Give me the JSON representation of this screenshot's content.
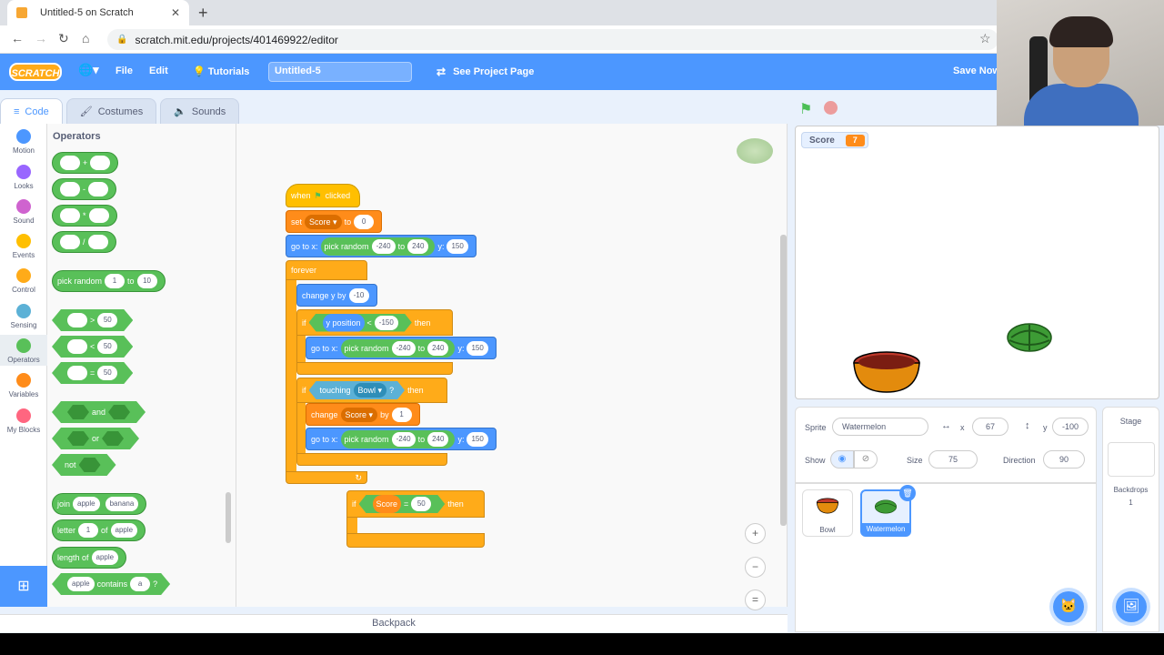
{
  "browser": {
    "tab_title": "Untitled-5 on Scratch",
    "url": "scratch.mit.edu/projects/401469922/editor"
  },
  "menubar": {
    "logo": "SCRATCH",
    "file": "File",
    "edit": "Edit",
    "tutorials": "Tutorials",
    "project_title": "Untitled-5",
    "see_project": "See Project Page",
    "save_now": "Save Now"
  },
  "tabs": {
    "code": "Code",
    "costumes": "Costumes",
    "sounds": "Sounds"
  },
  "categories": [
    {
      "label": "Motion",
      "color": "#4c97ff"
    },
    {
      "label": "Looks",
      "color": "#9966ff"
    },
    {
      "label": "Sound",
      "color": "#cf63cf"
    },
    {
      "label": "Events",
      "color": "#ffbf00"
    },
    {
      "label": "Control",
      "color": "#ffab19"
    },
    {
      "label": "Sensing",
      "color": "#5cb1d6"
    },
    {
      "label": "Operators",
      "color": "#59c059"
    },
    {
      "label": "Variables",
      "color": "#ff8c1a"
    },
    {
      "label": "My Blocks",
      "color": "#ff6680"
    }
  ],
  "palette": {
    "title": "Operators",
    "plus": "+",
    "minus": "-",
    "times": "*",
    "divide": "/",
    "pick_random": "pick random",
    "to": "to",
    "rand_from": "1",
    "rand_to": "10",
    "gt": ">",
    "lt": "<",
    "eq": "=",
    "cmp_val": "50",
    "and": "and",
    "or": "or",
    "not": "not",
    "join": "join",
    "join_a": "apple",
    "join_b": "banana",
    "letter": "letter",
    "letter_n": "1",
    "of": "of",
    "letter_word": "apple",
    "length_of": "length of",
    "length_word": "apple",
    "contains_word": "apple",
    "contains": "contains",
    "contains_char": "a",
    "q": "?"
  },
  "script": {
    "when": "when",
    "clicked": "clicked",
    "set": "set",
    "score_var": "Score",
    "to": "to",
    "set_val": "0",
    "go_to": "go to x:",
    "pick_random": "pick random",
    "r_from": "-240",
    "r_to": "240",
    "y": "y:",
    "y_val": "150",
    "forever": "forever",
    "change_y": "change y by",
    "change_y_val": "-10",
    "if": "if",
    "then": "then",
    "y_position": "y position",
    "lt": "<",
    "y_limit": "-150",
    "touching": "touching",
    "bowl": "Bowl",
    "q": "?",
    "change": "change",
    "by": "by",
    "change_val": "1",
    "eq": "=",
    "score_target": "50"
  },
  "stage": {
    "monitor_label": "Score",
    "monitor_value": "7"
  },
  "sprite_info": {
    "sprite_label": "Sprite",
    "sprite_name": "Watermelon",
    "x_label": "x",
    "x_val": "67",
    "y_label": "y",
    "y_val": "-100",
    "show_label": "Show",
    "size_label": "Size",
    "size_val": "75",
    "direction_label": "Direction",
    "direction_val": "90"
  },
  "sprites": [
    {
      "name": "Bowl"
    },
    {
      "name": "Watermelon"
    }
  ],
  "stage_pane": {
    "title": "Stage",
    "backdrops_label": "Backdrops",
    "backdrops_count": "1"
  },
  "backpack": "Backpack"
}
